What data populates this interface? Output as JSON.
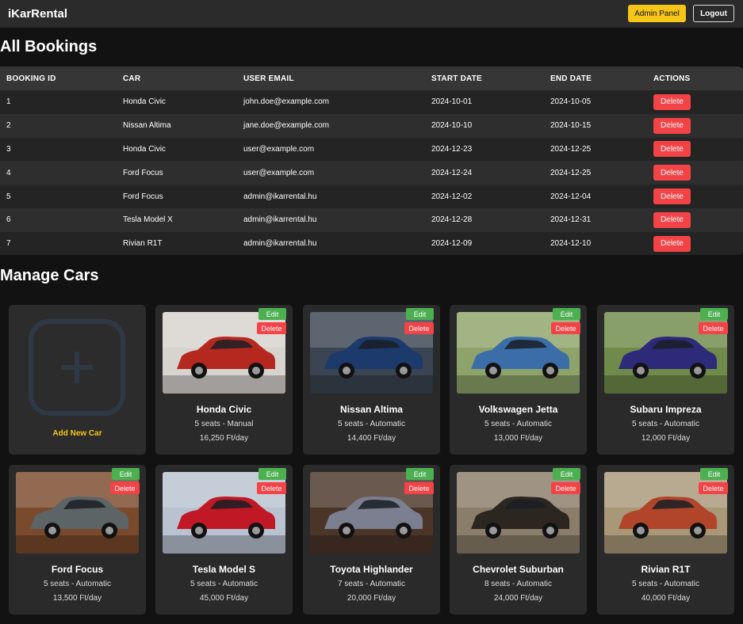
{
  "navbar": {
    "brand": "iKarRental",
    "admin_label": "Admin Panel",
    "logout_label": "Logout"
  },
  "bookings": {
    "title": "All Bookings",
    "columns": [
      "BOOKING ID",
      "CAR",
      "USER EMAIL",
      "START DATE",
      "END DATE",
      "ACTIONS"
    ],
    "delete_label": "Delete",
    "rows": [
      {
        "id": "1",
        "car": "Honda Civic",
        "email": "john.doe@example.com",
        "start": "2024-10-01",
        "end": "2024-10-05"
      },
      {
        "id": "2",
        "car": "Nissan Altima",
        "email": "jane.doe@example.com",
        "start": "2024-10-10",
        "end": "2024-10-15"
      },
      {
        "id": "3",
        "car": "Honda Civic",
        "email": "user@example.com",
        "start": "2024-12-23",
        "end": "2024-12-25"
      },
      {
        "id": "4",
        "car": "Ford Focus",
        "email": "user@example.com",
        "start": "2024-12-24",
        "end": "2024-12-25"
      },
      {
        "id": "5",
        "car": "Ford Focus",
        "email": "admin@ikarrental.hu",
        "start": "2024-12-02",
        "end": "2024-12-04"
      },
      {
        "id": "6",
        "car": "Tesla Model X",
        "email": "admin@ikarrental.hu",
        "start": "2024-12-28",
        "end": "2024-12-31"
      },
      {
        "id": "7",
        "car": "Rivian R1T",
        "email": "admin@ikarrental.hu",
        "start": "2024-12-09",
        "end": "2024-12-10"
      }
    ]
  },
  "cars_section": {
    "title": "Manage Cars",
    "add_label": "Add New Car",
    "edit_label": "Edit",
    "delete_label": "Delete",
    "cars": [
      {
        "name": "Honda Civic",
        "spec": "5 seats - Manual",
        "price": "16,250 Ft/day",
        "color": "#b5281f",
        "bg": "#d7d3cf"
      },
      {
        "name": "Nissan Altima",
        "spec": "5 seats - Automatic",
        "price": "14,400 Ft/day",
        "color": "#1c3a6b",
        "bg": "#3a4452"
      },
      {
        "name": "Volkswagen Jetta",
        "spec": "5 seats - Automatic",
        "price": "13,000 Ft/day",
        "color": "#3b6ea8",
        "bg": "#8ea36a"
      },
      {
        "name": "Subaru Impreza",
        "spec": "5 seats - Automatic",
        "price": "12,000 Ft/day",
        "color": "#2e2a7a",
        "bg": "#6f8a4a"
      },
      {
        "name": "Ford Focus",
        "spec": "5 seats - Automatic",
        "price": "13,500 Ft/day",
        "color": "#5d6466",
        "bg": "#7a4a2c"
      },
      {
        "name": "Tesla Model S",
        "spec": "5 seats - Automatic",
        "price": "45,000 Ft/day",
        "color": "#c01824",
        "bg": "#b8c2d0"
      },
      {
        "name": "Toyota Highlander",
        "spec": "7 seats - Automatic",
        "price": "20,000 Ft/day",
        "color": "#7b7f90",
        "bg": "#4a3528"
      },
      {
        "name": "Chevrolet Suburban",
        "spec": "8 seats - Automatic",
        "price": "24,000 Ft/day",
        "color": "#2c2620",
        "bg": "#8a7d6a"
      },
      {
        "name": "Rivian R1T",
        "spec": "5 seats - Automatic",
        "price": "40,000 Ft/day",
        "color": "#b0452a",
        "bg": "#a89878"
      }
    ]
  }
}
